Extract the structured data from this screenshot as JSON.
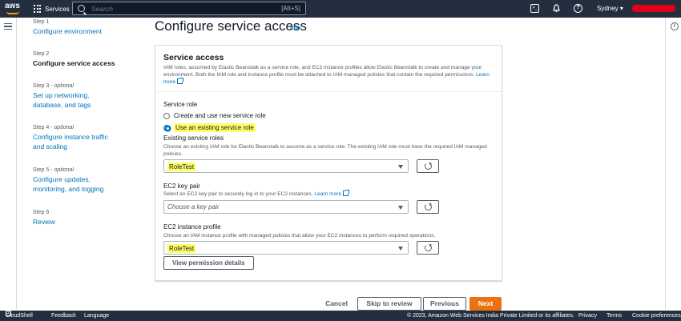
{
  "topnav": {
    "logo": "aws",
    "services_label": "Services",
    "search_placeholder": "Search",
    "search_shortcut": "[Alt+S]",
    "region": "Sydney"
  },
  "icons": {
    "cloudshell": "terminal-icon",
    "notifications": "bell-icon",
    "help": "question-icon",
    "info_panel": "info-icon"
  },
  "steps": [
    {
      "num": "Step 1",
      "optional": "",
      "title": "Configure environment"
    },
    {
      "num": "Step 2",
      "optional": "",
      "title": "Configure service access"
    },
    {
      "num": "Step 3 -",
      "optional": "optional",
      "title": "Set up networking, database, and tags"
    },
    {
      "num": "Step 4 -",
      "optional": "optional",
      "title": "Configure instance traffic and scaling"
    },
    {
      "num": "Step 5 -",
      "optional": "optional",
      "title": "Configure updates, monitoring, and logging"
    },
    {
      "num": "Step 6",
      "optional": "",
      "title": "Review"
    }
  ],
  "page": {
    "title": "Configure service access",
    "info": "Info"
  },
  "panel": {
    "title": "Service access",
    "desc": "IAM roles, assumed by Elastic Beanstalk as a service role, and EC2 instance profiles allow Elastic Beanstalk to create and manage your environment. Both the IAM role and instance profile must be attached to IAM managed policies that contain the required permissions.",
    "learn_more": "Learn more",
    "service_role_label": "Service role",
    "radio_new": "Create and use new service role",
    "radio_existing": "Use an existing service role",
    "existing_roles_label": "Existing service roles",
    "existing_roles_desc": "Choose an existing IAM role for Elastic Beanstalk to assume as a service role. The existing IAM role must have the required IAM managed policies.",
    "existing_roles_value": "RoleTest",
    "keypair_label": "EC2 key pair",
    "keypair_desc": "Select an EC2 key pair to securely log in to your EC2 instances.",
    "keypair_learn_more": "Learn more",
    "keypair_placeholder": "Choose a key pair",
    "profile_label": "EC2 instance profile",
    "profile_desc": "Choose an IAM instance profile with managed policies that allow your EC2 instances to perform required operations.",
    "profile_value": "RoleTest",
    "view_permissions": "View permission details"
  },
  "actions": {
    "cancel": "Cancel",
    "skip": "Skip to review",
    "previous": "Previous",
    "next": "Next"
  },
  "bottombar": {
    "cloudshell": "CloudShell",
    "feedback": "Feedback",
    "language": "Language",
    "copyright": "© 2023, Amazon Web Services India Private Limited or its affiliates.",
    "privacy": "Privacy",
    "terms": "Terms",
    "cookies": "Cookie preferences"
  },
  "colors": {
    "nav_bg": "#232f3e",
    "link": "#0073bb",
    "primary": "#ec7211",
    "highlight": "#ffff66",
    "account_redacted": "#e0001a"
  }
}
